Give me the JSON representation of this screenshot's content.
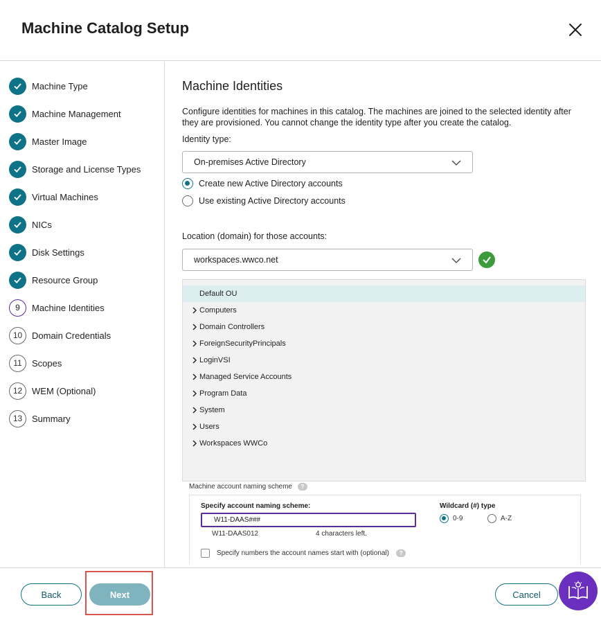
{
  "dialog": {
    "title": "Machine Catalog Setup"
  },
  "steps": [
    {
      "label": "Machine Type",
      "state": "done"
    },
    {
      "label": "Machine Management",
      "state": "done"
    },
    {
      "label": "Master Image",
      "state": "done"
    },
    {
      "label": "Storage and License Types",
      "state": "done"
    },
    {
      "label": "Virtual Machines",
      "state": "done"
    },
    {
      "label": "NICs",
      "state": "done"
    },
    {
      "label": "Disk Settings",
      "state": "done"
    },
    {
      "label": "Resource Group",
      "state": "done"
    },
    {
      "label": "Machine Identities",
      "state": "current",
      "number": "9"
    },
    {
      "label": "Domain Credentials",
      "state": "pending",
      "number": "10"
    },
    {
      "label": "Scopes",
      "state": "pending",
      "number": "11"
    },
    {
      "label": "WEM (Optional)",
      "state": "pending",
      "number": "12"
    },
    {
      "label": "Summary",
      "state": "pending",
      "number": "13"
    }
  ],
  "main": {
    "title": "Machine Identities",
    "description": "Configure identities for machines in this catalog. The machines are joined to the selected identity after they are provisioned. You cannot change the identity type after you create the catalog.",
    "identity_type_label": "Identity type:",
    "identity_type_value": "On-premises Active Directory",
    "radio_create": "Create new Active Directory accounts",
    "radio_existing": "Use existing Active Directory accounts",
    "location_label": "Location (domain) for those accounts:",
    "location_value": "workspaces.wwco.net",
    "ou_tree": [
      {
        "label": "Default OU",
        "selected": true,
        "expandable": false
      },
      {
        "label": "Computers",
        "expandable": true
      },
      {
        "label": "Domain Controllers",
        "expandable": true
      },
      {
        "label": "ForeignSecurityPrincipals",
        "expandable": true
      },
      {
        "label": "LoginVSI",
        "expandable": true
      },
      {
        "label": "Managed Service Accounts",
        "expandable": true
      },
      {
        "label": "Program Data",
        "expandable": true
      },
      {
        "label": "System",
        "expandable": true
      },
      {
        "label": "Users",
        "expandable": true
      },
      {
        "label": "Workspaces WWCo",
        "expandable": true
      }
    ],
    "naming": {
      "section_title": "Machine account naming scheme",
      "help": "?",
      "specify_label": "Specify account naming scheme:",
      "scheme_value": "W11-DAAS###",
      "preview": "W11-DAAS012",
      "chars_left": "4 characters left.",
      "wildcard_label": "Wildcard (#) type",
      "wildcard_options": [
        "0-9",
        "A-Z"
      ],
      "wildcard_selected": "0-9",
      "start_numbers_label": "Specify numbers the account names start with (optional)"
    }
  },
  "footer": {
    "back_label": "Back",
    "next_label": "Next",
    "cancel_label": "Cancel"
  },
  "colors": {
    "accent": "#0f7387",
    "current_step": "#5b2c9e",
    "valid": "#3d9b3d",
    "highlight": "#d9534f",
    "assistant": "#6a2fbf"
  }
}
